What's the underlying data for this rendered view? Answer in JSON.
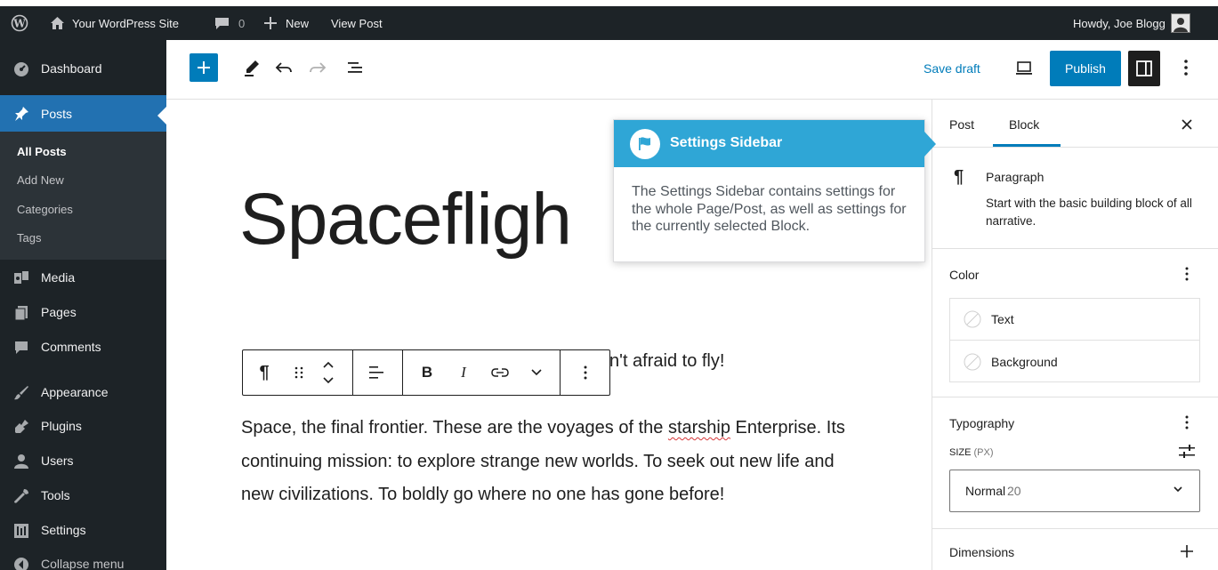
{
  "admin_bar": {
    "site_name": "Your WordPress Site",
    "comments_count": "0",
    "new_label": "New",
    "view_post_label": "View Post",
    "howdy_label": "Howdy, Joe Blogg"
  },
  "admin_menu": {
    "items": [
      {
        "label": "Dashboard",
        "icon": "dashboard-icon"
      },
      {
        "label": "Posts",
        "icon": "pin-icon",
        "current": true
      },
      {
        "label": "Media",
        "icon": "media-icon"
      },
      {
        "label": "Pages",
        "icon": "pages-icon"
      },
      {
        "label": "Comments",
        "icon": "comments-icon"
      },
      {
        "label": "Appearance",
        "icon": "brush-icon"
      },
      {
        "label": "Plugins",
        "icon": "plugin-icon"
      },
      {
        "label": "Users",
        "icon": "users-icon"
      },
      {
        "label": "Tools",
        "icon": "wrench-icon"
      },
      {
        "label": "Settings",
        "icon": "settings-icon"
      },
      {
        "label": "Collapse menu",
        "icon": "collapse-icon"
      }
    ],
    "submenu": [
      {
        "label": "All Posts",
        "current": true
      },
      {
        "label": "Add New"
      },
      {
        "label": "Categories"
      },
      {
        "label": "Tags"
      }
    ]
  },
  "editor_toolbar": {
    "save_draft_label": "Save draft",
    "publish_label": "Publish"
  },
  "post": {
    "title_visible": "Spacefligh",
    "paragraph1_visible": "n't afraid to fly!",
    "body_pre": "Space, the final frontier. These are the voyages of the ",
    "body_misspelled": "starship",
    "body_post": " Enterprise. Its continuing mission: to explore strange new worlds. To seek out new life and new civilizations. To boldly go where no one has gone before!"
  },
  "sidebar": {
    "tab_post": "Post",
    "tab_block": "Block",
    "block_name": "Paragraph",
    "block_description": "Start with the basic building block of all narrative.",
    "color_panel": {
      "title": "Color",
      "text_label": "Text",
      "background_label": "Background"
    },
    "typography_panel": {
      "title": "Typography",
      "size_label": "SIZE",
      "size_unit": "(PX)",
      "size_value": "Normal",
      "size_number": "20"
    },
    "dimensions_panel": {
      "title": "Dimensions"
    }
  },
  "tour": {
    "title": "Settings Sidebar",
    "body": "The Settings Sidebar contains settings for the whole Page/Post, as well as settings for the currently selected Block."
  },
  "colors": {
    "admin_bg": "#1d2327",
    "accent": "#2271b1",
    "button_blue": "#007cba",
    "tour_header": "#2fa6d6"
  }
}
